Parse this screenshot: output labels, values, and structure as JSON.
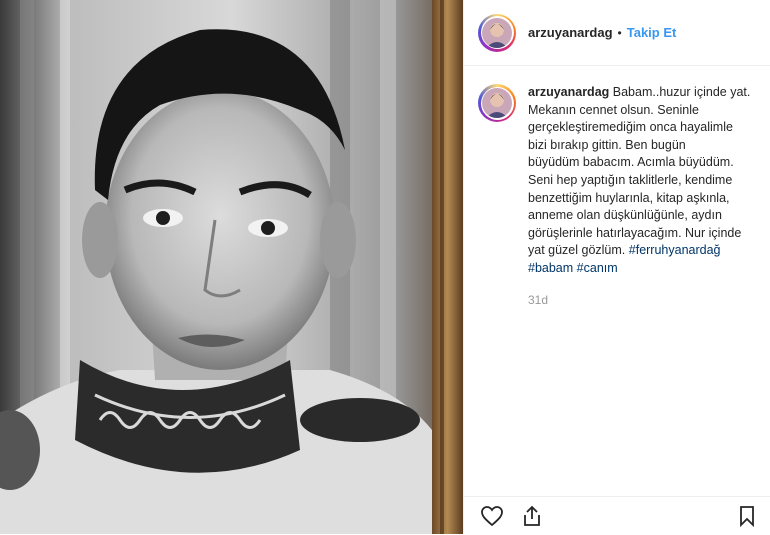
{
  "post": {
    "username": "arzuyanardag",
    "separator": "•",
    "follow_label": "Takip Et",
    "caption_lines": [
      "Babam..huzur içinde yat.",
      "Mekanın cennet olsun. Seninle",
      "gerçekleştiremediğim onca hayalimle",
      "bizi bırakıp gittin. Ben bugün",
      "büyüdüm babacım. Acımla büyüdüm.",
      "Seni hep yaptığın taklitlerle, kendime",
      "benzettiğim huylarınla, kitap aşkınla,",
      "anneme olan düşkünlüğünle, aydın",
      "görüşlerinle hatırlayacağım. Nur içinde",
      "yat güzel gözlüm."
    ],
    "hashtags": [
      "#ferruhyanardağ",
      "#babam",
      "#canım"
    ],
    "time": "31d"
  },
  "icons": {
    "like": "heart-icon",
    "share": "share-icon",
    "save": "bookmark-icon"
  },
  "colors": {
    "follow_blue": "#3897f0",
    "hashtag_blue": "#003569"
  }
}
